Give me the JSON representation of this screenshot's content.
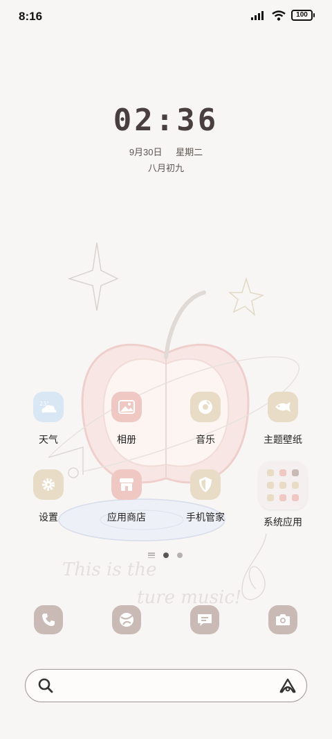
{
  "status_bar": {
    "time": "8:16",
    "battery": "100"
  },
  "clock": {
    "time": "02:36",
    "date": "9月30日",
    "weekday": "星期二",
    "lunar": "八月初九"
  },
  "wallpaper_text": {
    "line1": "This is the",
    "line2": "ture music!"
  },
  "apps": [
    {
      "label": "天气",
      "icon": "weather-icon",
      "color": "#d9e6f4"
    },
    {
      "label": "相册",
      "icon": "photo-icon",
      "color": "#efc8c4"
    },
    {
      "label": "音乐",
      "icon": "music-icon",
      "color": "#e8dcc7"
    },
    {
      "label": "主题壁纸",
      "icon": "fish-icon",
      "color": "#e8dcc7"
    },
    {
      "label": "设置",
      "icon": "gear-icon",
      "color": "#e8dcc7"
    },
    {
      "label": "应用商店",
      "icon": "store-icon",
      "color": "#efc8c4"
    },
    {
      "label": "手机管家",
      "icon": "shield-icon",
      "color": "#e8dcc7"
    },
    {
      "label": "系统应用",
      "icon": "folder-icon",
      "color": "#f2eeec"
    }
  ],
  "page_indicator": {
    "pages": 2,
    "active": 1
  },
  "dock": [
    {
      "icon": "phone-icon"
    },
    {
      "icon": "browser-icon"
    },
    {
      "icon": "message-icon"
    },
    {
      "icon": "camera-icon"
    }
  ],
  "colors": {
    "dock_bg": "#c9bab5",
    "background": "#f8f6f4"
  }
}
